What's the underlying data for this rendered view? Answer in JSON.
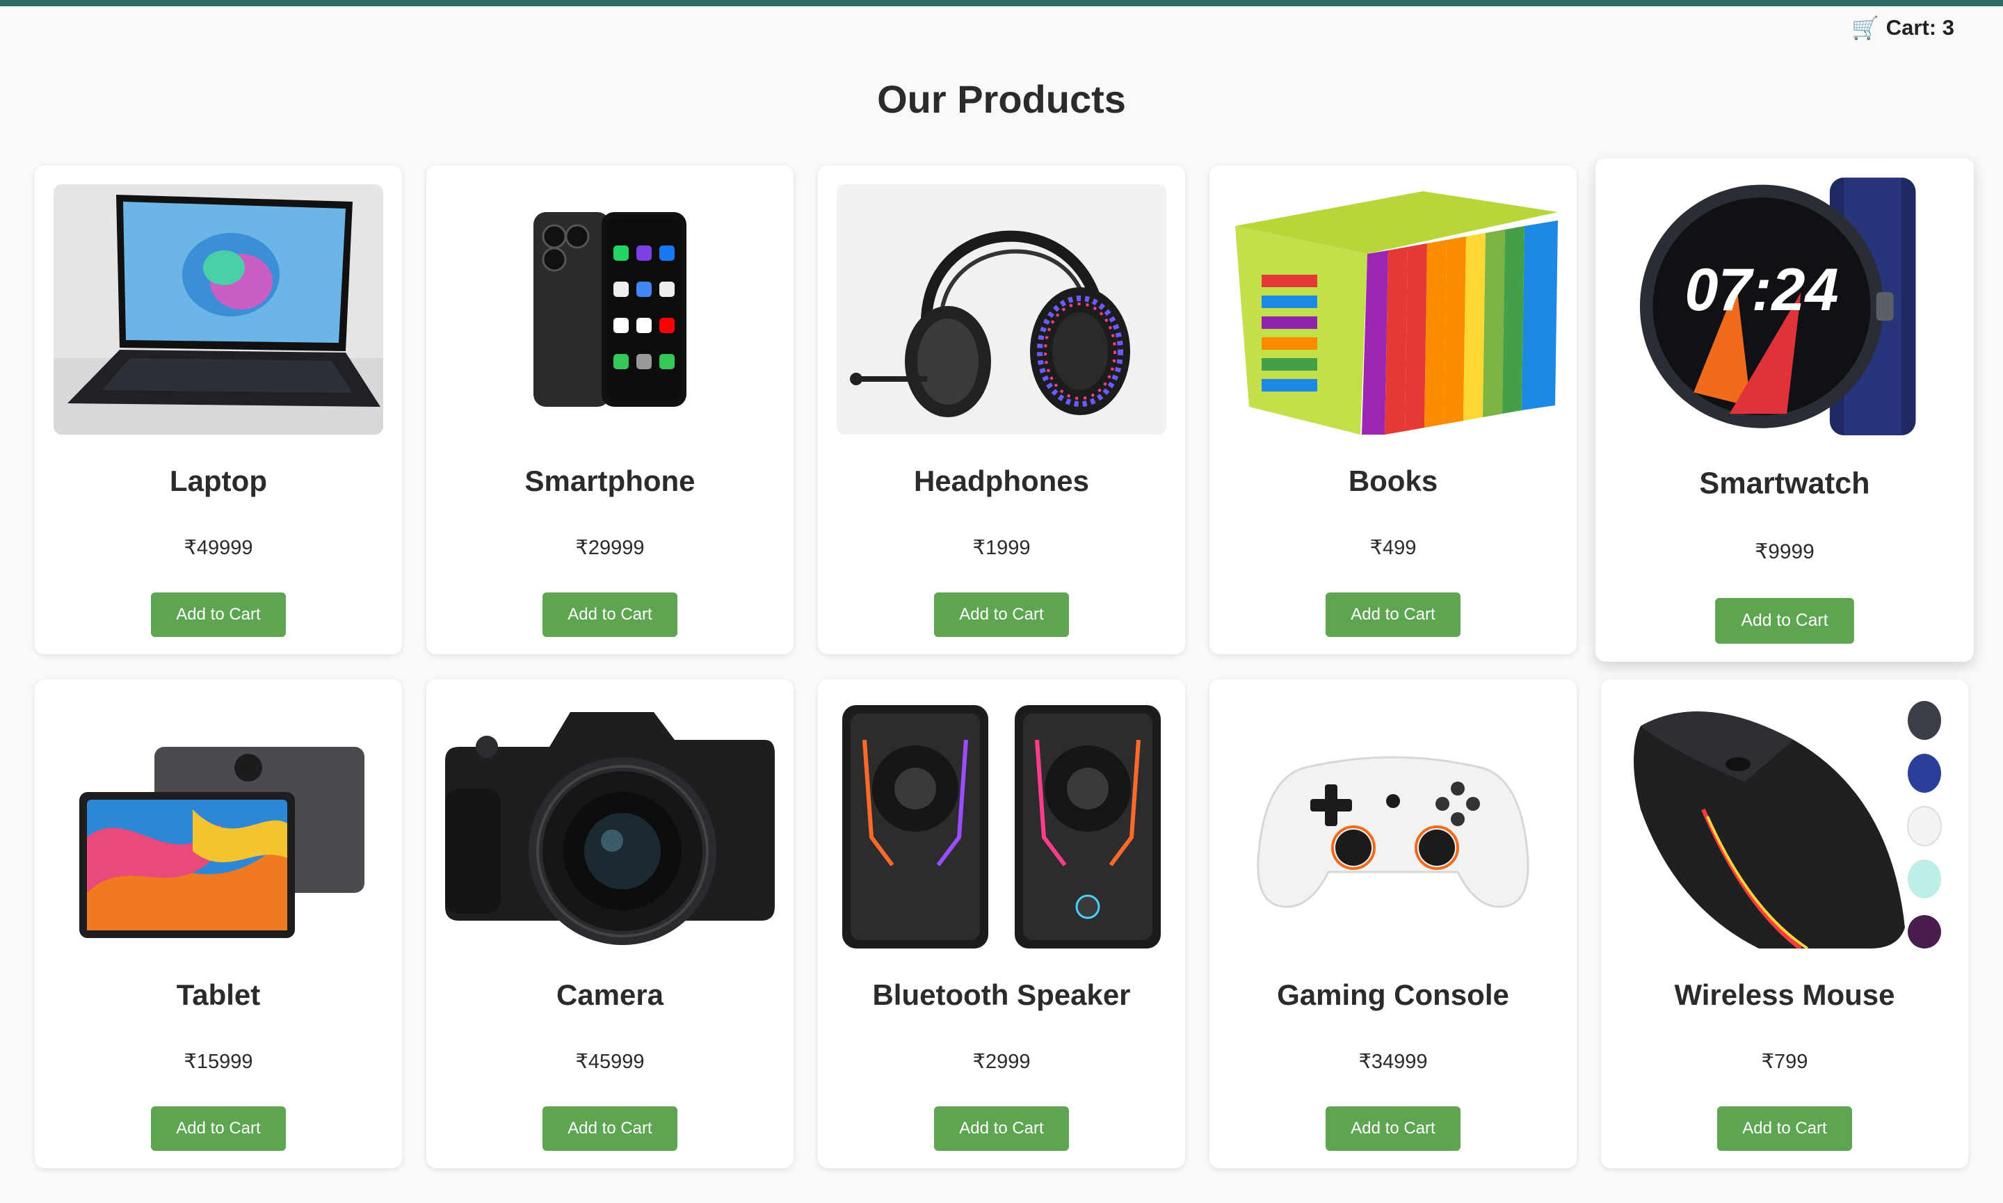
{
  "header": {
    "cart_icon": "🛒",
    "cart_label": "Cart: 3"
  },
  "title": "Our Products",
  "colors": {
    "accent": "#2e6b64",
    "button": "#5da550",
    "background": "#f9f9f9"
  },
  "products": [
    {
      "name": "Laptop",
      "price": "₹49999",
      "button": "Add to Cart",
      "image_icon": "laptop-icon"
    },
    {
      "name": "Smartphone",
      "price": "₹29999",
      "button": "Add to Cart",
      "image_icon": "smartphone-icon"
    },
    {
      "name": "Headphones",
      "price": "₹1999",
      "button": "Add to Cart",
      "image_icon": "headphones-icon"
    },
    {
      "name": "Books",
      "price": "₹499",
      "button": "Add to Cart",
      "image_icon": "books-icon"
    },
    {
      "name": "Smartwatch",
      "price": "₹9999",
      "button": "Add to Cart",
      "image_icon": "smartwatch-icon"
    },
    {
      "name": "Tablet",
      "price": "₹15999",
      "button": "Add to Cart",
      "image_icon": "tablet-icon"
    },
    {
      "name": "Camera",
      "price": "₹45999",
      "button": "Add to Cart",
      "image_icon": "camera-icon"
    },
    {
      "name": "Bluetooth Speaker",
      "price": "₹2999",
      "button": "Add to Cart",
      "image_icon": "speaker-icon"
    },
    {
      "name": "Gaming Console",
      "price": "₹34999",
      "button": "Add to Cart",
      "image_icon": "gamepad-icon"
    },
    {
      "name": "Wireless Mouse",
      "price": "₹799",
      "button": "Add to Cart",
      "image_icon": "mouse-icon"
    }
  ]
}
